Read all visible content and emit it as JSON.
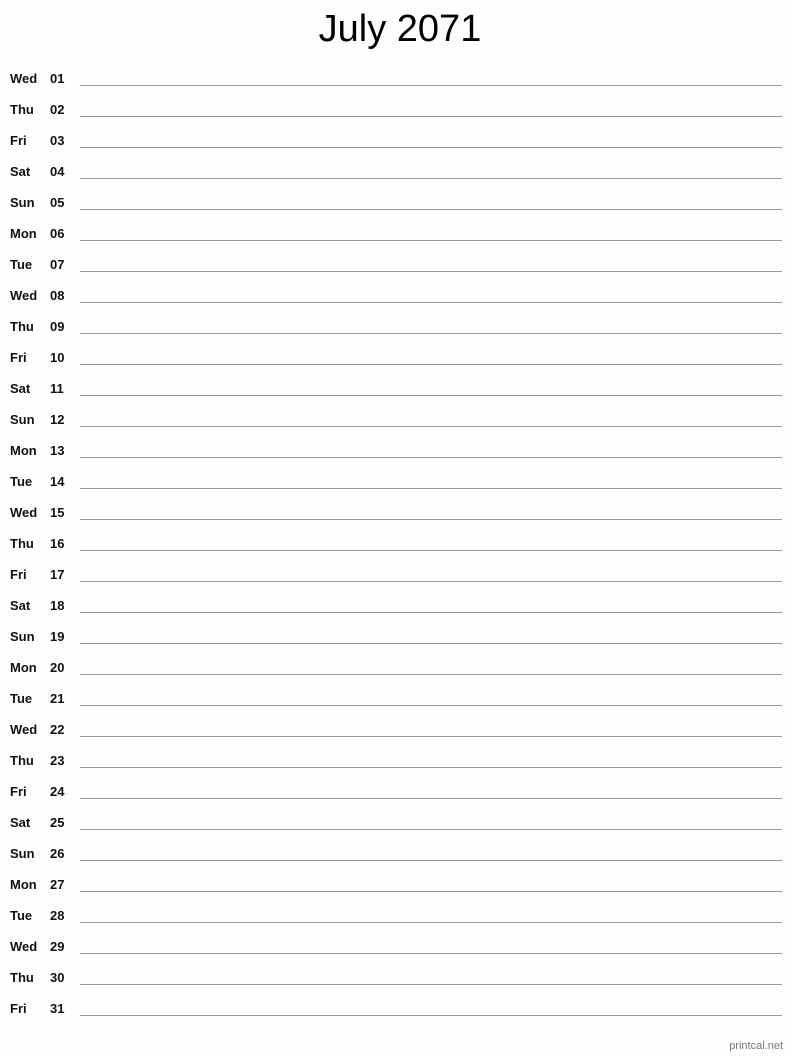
{
  "title": "July 2071",
  "days": [
    {
      "dow": "Wed",
      "num": "01"
    },
    {
      "dow": "Thu",
      "num": "02"
    },
    {
      "dow": "Fri",
      "num": "03"
    },
    {
      "dow": "Sat",
      "num": "04"
    },
    {
      "dow": "Sun",
      "num": "05"
    },
    {
      "dow": "Mon",
      "num": "06"
    },
    {
      "dow": "Tue",
      "num": "07"
    },
    {
      "dow": "Wed",
      "num": "08"
    },
    {
      "dow": "Thu",
      "num": "09"
    },
    {
      "dow": "Fri",
      "num": "10"
    },
    {
      "dow": "Sat",
      "num": "11"
    },
    {
      "dow": "Sun",
      "num": "12"
    },
    {
      "dow": "Mon",
      "num": "13"
    },
    {
      "dow": "Tue",
      "num": "14"
    },
    {
      "dow": "Wed",
      "num": "15"
    },
    {
      "dow": "Thu",
      "num": "16"
    },
    {
      "dow": "Fri",
      "num": "17"
    },
    {
      "dow": "Sat",
      "num": "18"
    },
    {
      "dow": "Sun",
      "num": "19"
    },
    {
      "dow": "Mon",
      "num": "20"
    },
    {
      "dow": "Tue",
      "num": "21"
    },
    {
      "dow": "Wed",
      "num": "22"
    },
    {
      "dow": "Thu",
      "num": "23"
    },
    {
      "dow": "Fri",
      "num": "24"
    },
    {
      "dow": "Sat",
      "num": "25"
    },
    {
      "dow": "Sun",
      "num": "26"
    },
    {
      "dow": "Mon",
      "num": "27"
    },
    {
      "dow": "Tue",
      "num": "28"
    },
    {
      "dow": "Wed",
      "num": "29"
    },
    {
      "dow": "Thu",
      "num": "30"
    },
    {
      "dow": "Fri",
      "num": "31"
    }
  ],
  "footer": "printcal.net"
}
